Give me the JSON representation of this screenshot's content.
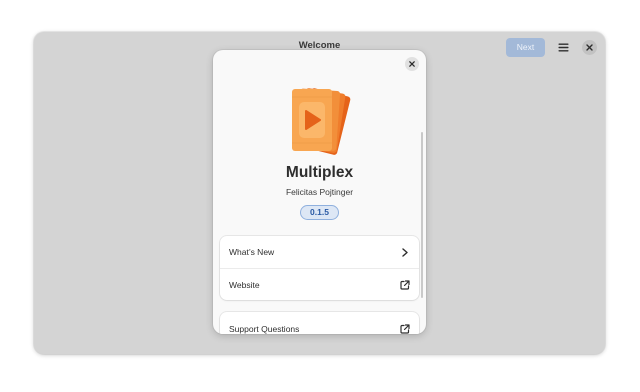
{
  "window": {
    "title": "Welcome",
    "next_label": "Next",
    "menu_icon": "hamburger-menu-icon",
    "close_icon": "close-icon"
  },
  "about": {
    "close_icon": "close-icon",
    "app_icon": "multiplex-app-icon",
    "app_name": "Multiplex",
    "developer": "Felicitas Pojtinger",
    "version": "0.1.5",
    "rows": [
      {
        "label": "What’s New",
        "icon": "chevron-right-icon"
      },
      {
        "label": "Website",
        "icon": "external-link-icon"
      }
    ],
    "rows2": [
      {
        "label": "Support Questions",
        "icon": "external-link-icon"
      }
    ]
  },
  "colors": {
    "accent": "#3584e4",
    "icon_orange": "#f6a24a",
    "icon_dark_orange": "#e5631a"
  }
}
